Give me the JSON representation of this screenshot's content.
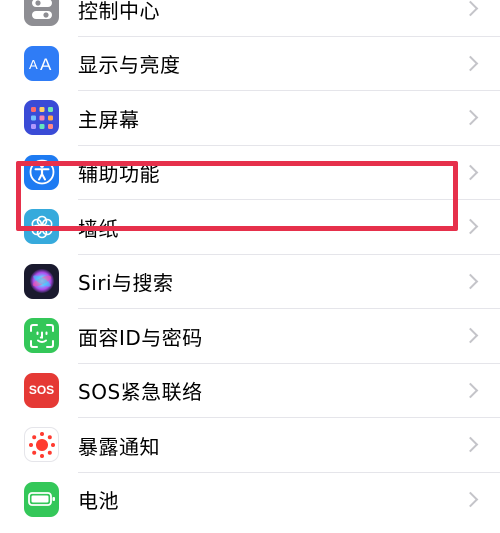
{
  "settings_list": {
    "items": [
      {
        "label": "控制中心",
        "icon": "control-center-icon",
        "color": "#8e8e93"
      },
      {
        "label": "显示与亮度",
        "icon": "display-brightness-icon",
        "color": "#2f7cf6"
      },
      {
        "label": "主屏幕",
        "icon": "home-screen-icon",
        "color": "#3a4bd6"
      },
      {
        "label": "辅助功能",
        "icon": "accessibility-icon",
        "color": "#1e7bf2"
      },
      {
        "label": "墙纸",
        "icon": "wallpaper-icon",
        "color": "#36aadc"
      },
      {
        "label": "Siri与搜索",
        "icon": "siri-icon",
        "color": "#1a1a2e"
      },
      {
        "label": "面容ID与密码",
        "icon": "face-id-icon",
        "color": "#34c759"
      },
      {
        "label": "SOS紧急联络",
        "icon": "emergency-sos-icon",
        "color": "#e53935",
        "icon_text": "SOS"
      },
      {
        "label": "暴露通知",
        "icon": "exposure-notification-icon",
        "color": "#ffffff"
      },
      {
        "label": "电池",
        "icon": "battery-icon",
        "color": "#34c759"
      }
    ]
  },
  "highlight": {
    "target": "辅助功能",
    "color": "#e6304b"
  }
}
